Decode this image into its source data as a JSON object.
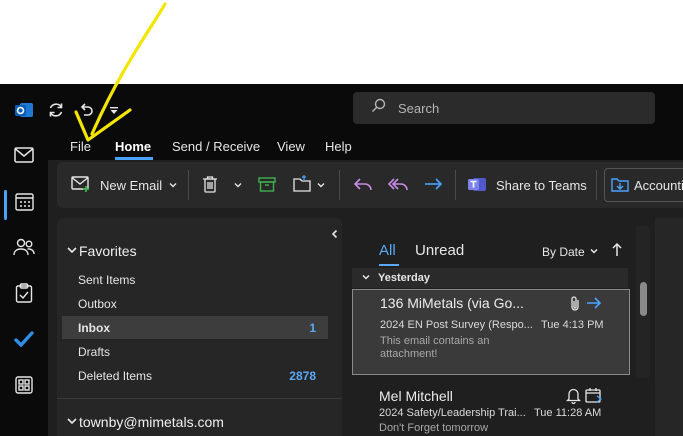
{
  "app": "Outlook",
  "search": {
    "placeholder": "Search"
  },
  "menu": [
    "File",
    "Home",
    "Send / Receive",
    "View",
    "Help"
  ],
  "ribbon": {
    "new_email": "New Email",
    "share_to_teams": "Share to Teams",
    "accounting": "Accounting"
  },
  "favorites": {
    "header": "Favorites",
    "items": [
      {
        "label": "Sent Items",
        "count": ""
      },
      {
        "label": "Outbox",
        "count": ""
      },
      {
        "label": "Inbox",
        "count": "1"
      },
      {
        "label": "Drafts",
        "count": ""
      },
      {
        "label": "Deleted Items",
        "count": "2878"
      }
    ]
  },
  "account": "townby@mimetals.com",
  "message_list": {
    "tabs": [
      "All",
      "Unread"
    ],
    "sort_label": "By Date",
    "group": "Yesterday",
    "messages": [
      {
        "sender": "136 MiMetals (via Go...",
        "subject": "2024 EN Post Survey (Respo...",
        "time": "Tue 4:13 PM",
        "preview": "This email contains an attachment!"
      },
      {
        "sender": "Mel Mitchell",
        "subject": "2024 Safety/Leadership Trai...",
        "time": "Tue 11:28 AM",
        "preview": "Don't Forget tomorrow"
      }
    ]
  },
  "colors": {
    "accent": "#4aa3ff",
    "annotation": "#f2e600"
  }
}
